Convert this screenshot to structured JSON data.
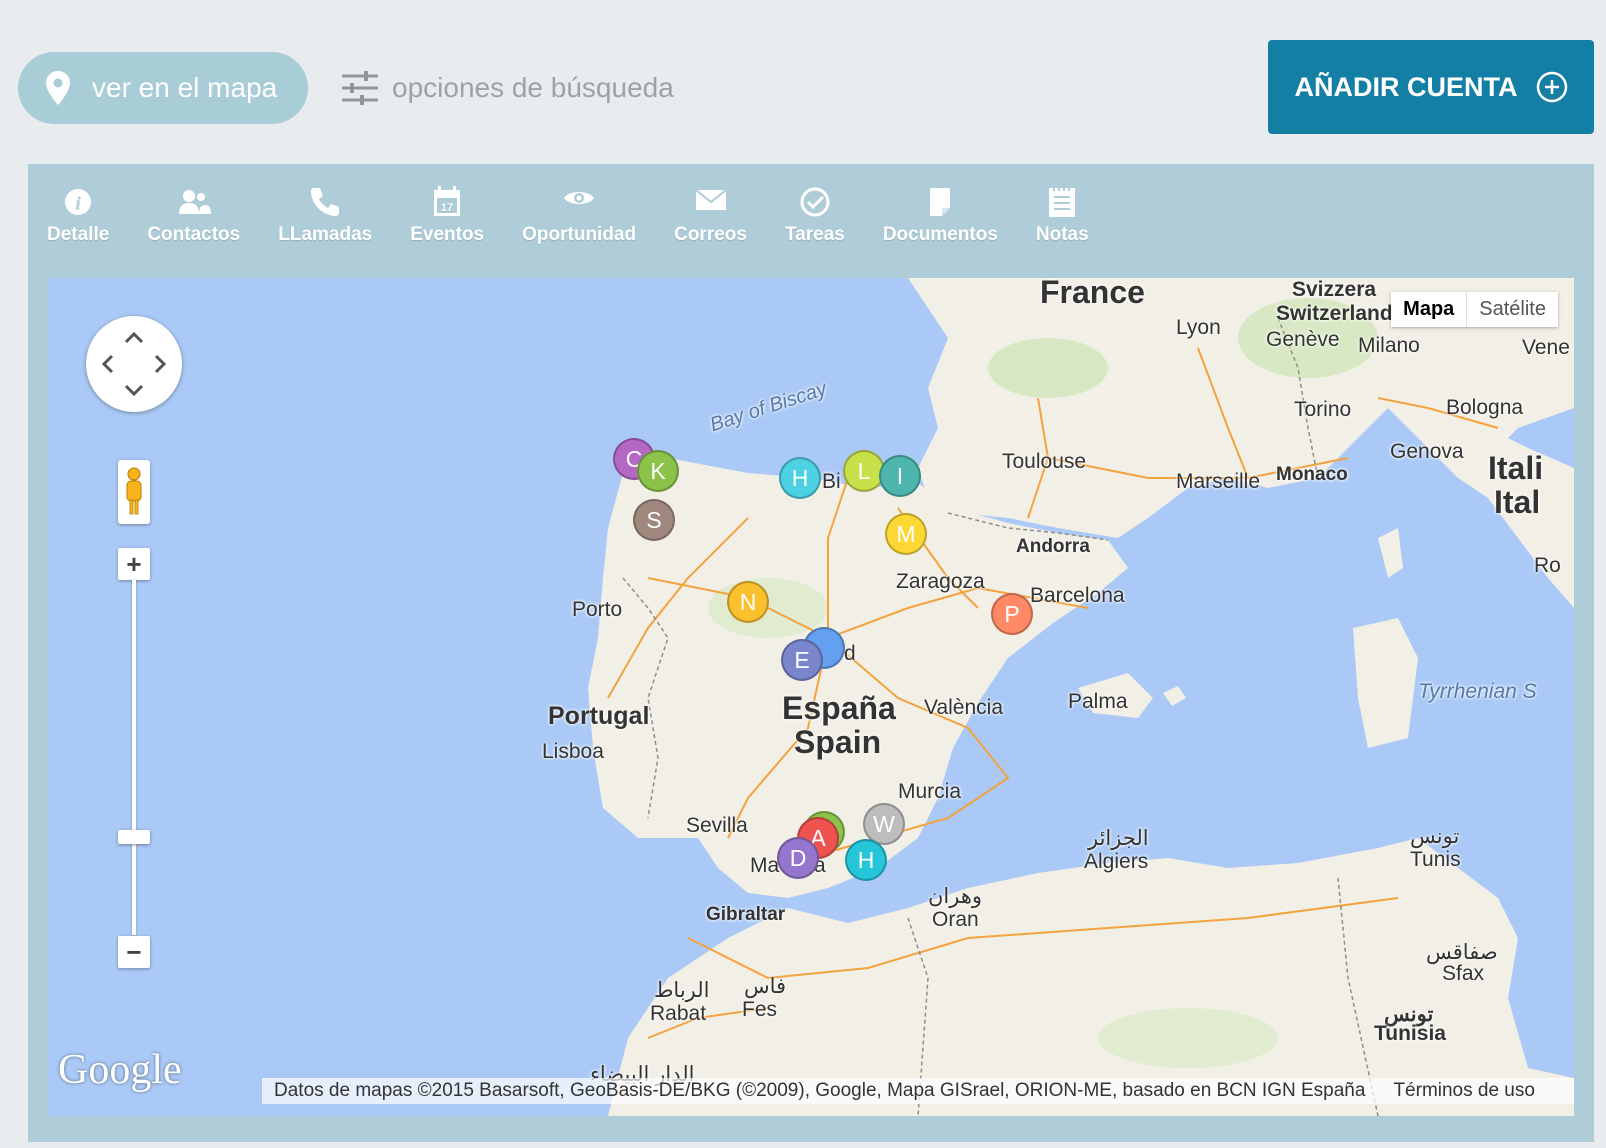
{
  "header": {
    "map_button": "ver en el mapa",
    "search_options": "opciones de búsqueda",
    "add_account": "AÑADIR CUENTA"
  },
  "tabs": [
    {
      "label": "Detalle",
      "icon": "info-icon"
    },
    {
      "label": "Contactos",
      "icon": "contacts-icon"
    },
    {
      "label": "LLamadas",
      "icon": "phone-icon"
    },
    {
      "label": "Eventos",
      "icon": "calendar-icon"
    },
    {
      "label": "Oportunidad",
      "icon": "eye-icon"
    },
    {
      "label": "Correos",
      "icon": "mail-icon"
    },
    {
      "label": "Tareas",
      "icon": "check-icon"
    },
    {
      "label": "Documentos",
      "icon": "document-icon"
    },
    {
      "label": "Notas",
      "icon": "notes-icon"
    }
  ],
  "map": {
    "type_options": [
      "Mapa",
      "Satélite"
    ],
    "selected_type": "Mapa",
    "logo": "Google",
    "attribution": "Datos de mapas ©2015 Basarsoft, GeoBasis-DE/BKG (©2009), Google, Mapa GISrael, ORION-ME, basado en BCN IGN España",
    "terms": "Términos de uso",
    "labels": {
      "france": "France",
      "svizzera": "Svizzera",
      "switzerland": "Switzerland",
      "lyon": "Lyon",
      "geneve": "Genève",
      "milano": "Milano",
      "venezia": "Vene",
      "torino": "Torino",
      "bologna": "Bologna",
      "genova": "Genova",
      "monaco": "Monaco",
      "italia": "Itali",
      "italy": "Ital",
      "roma": "Ro",
      "toulouse": "Toulouse",
      "marseille": "Marseille",
      "andorra": "Andorra",
      "bay_of_biscay": "Bay of Biscay",
      "bilbao": "Bi",
      "zaragoza": "Zaragoza",
      "barcelona": "Barcelona",
      "porto": "Porto",
      "madrid": "d",
      "espana": "España",
      "spain": "Spain",
      "portugal": "Portugal",
      "lisboa": "Lisboa",
      "valencia": "València",
      "palma": "Palma",
      "tyrrhenian": "Tyrrhenian S",
      "murcia": "Murcia",
      "sevilla": "Sevilla",
      "malaga": "Ma",
      "malaga2": "a",
      "gibraltar": "Gibraltar",
      "algiers_ar": "الجزائر",
      "algiers": "Algiers",
      "tunis_ar": "تونس",
      "tunis": "Tunis",
      "oran_ar": "وهران",
      "oran": "Oran",
      "sfax_ar": "صفاقس",
      "sfax": "Sfax",
      "tunisia_ar": "تونس",
      "tunisia": "Tunisia",
      "rabat_ar": "الرباط",
      "rabat": "Rabat",
      "fes_ar": "فاس",
      "fes": "Fes",
      "casablanca_ar": "الدار البيضاء"
    },
    "markers": [
      {
        "letter": "C",
        "color": "#b467c4"
      },
      {
        "letter": "K",
        "color": "#8bc34a"
      },
      {
        "letter": "S",
        "color": "#a1887f"
      },
      {
        "letter": "H",
        "color": "#4dd0e1"
      },
      {
        "letter": "L",
        "color": "#c8e04a"
      },
      {
        "letter": "I",
        "color": "#4db6ac"
      },
      {
        "letter": "M",
        "color": "#fdd835"
      },
      {
        "letter": "N",
        "color": "#fbc02d"
      },
      {
        "letter": "E",
        "color": "#7986cb"
      },
      {
        "letter": "P",
        "color": "#ff8a65"
      },
      {
        "letter": "W",
        "color": "#bdbdbd"
      },
      {
        "letter": "A",
        "color": "#ef5350"
      },
      {
        "letter": "D",
        "color": "#9575cd"
      },
      {
        "letter": "H",
        "color": "#26c6da"
      }
    ]
  }
}
